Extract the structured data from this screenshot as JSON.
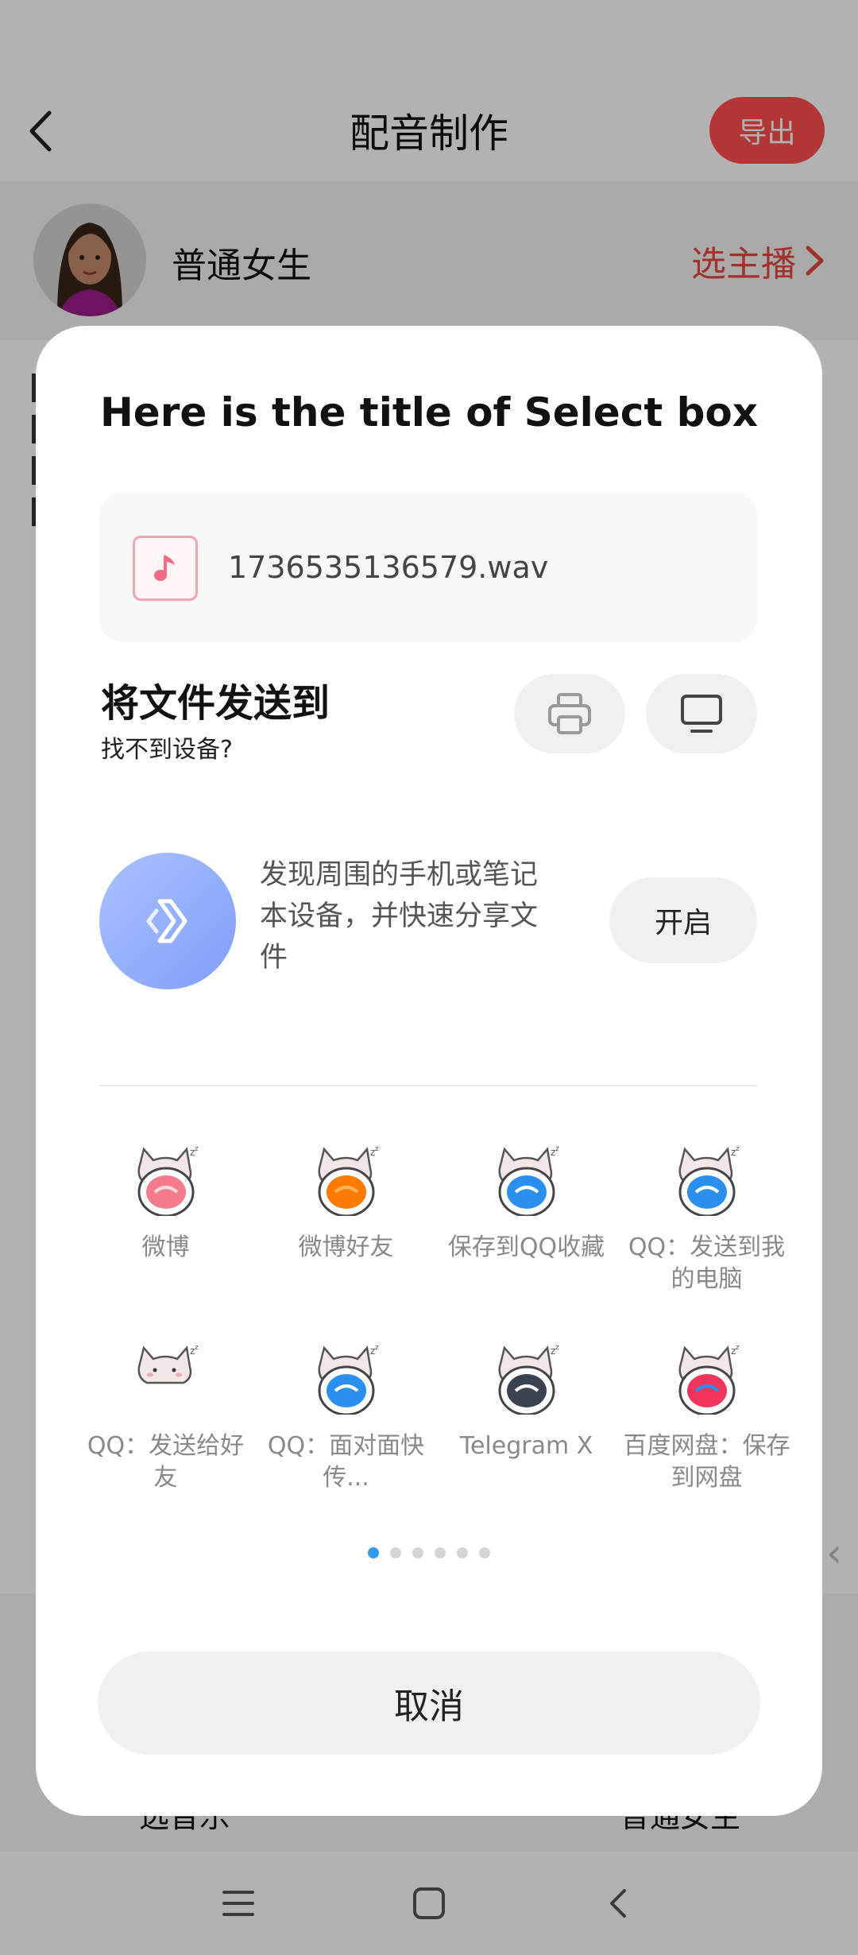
{
  "app": {
    "title": "配音制作",
    "export_label": "导出",
    "anchor_name": "普通女生",
    "choose_anchor_label": "选主播",
    "bottom_left_label": "选音乐",
    "bottom_right_label": "普通女生"
  },
  "sheet": {
    "title": "Here is the title of Select box",
    "file_name": "1736535136579.wav",
    "send_title": "将文件发送到",
    "send_subtitle": "找不到设备?",
    "discover_text": "发现周围的手机或笔记本设备，并快速分享文件",
    "enable_label": "开启",
    "share_targets": [
      {
        "label": "微博",
        "badge": "pink",
        "icon": "weibo-cat-icon"
      },
      {
        "label": "微博好友",
        "badge": "orange",
        "icon": "weibo-friends-cat-icon"
      },
      {
        "label": "保存到QQ收藏",
        "badge": "blue",
        "icon": "qq-favorites-cat-icon"
      },
      {
        "label": "QQ：发送到我的电脑",
        "badge": "blue",
        "icon": "qq-computer-cat-icon"
      },
      {
        "label": "QQ：发送给好友",
        "badge": "none",
        "icon": "qq-friend-cat-icon"
      },
      {
        "label": "QQ：面对面快传...",
        "badge": "blue",
        "icon": "qq-face-to-face-cat-icon"
      },
      {
        "label": "Telegram X",
        "badge": "dark",
        "icon": "telegram-cat-icon"
      },
      {
        "label": "百度网盘：保存到网盘",
        "badge": "red-blue",
        "icon": "baidu-netdisk-cat-icon"
      }
    ],
    "page_count": 6,
    "active_page": 1,
    "cancel_label": "取消"
  },
  "colors": {
    "accent": "#e8473f",
    "export_button": "#ff4f4b",
    "pager_active": "#2f9cf0"
  }
}
